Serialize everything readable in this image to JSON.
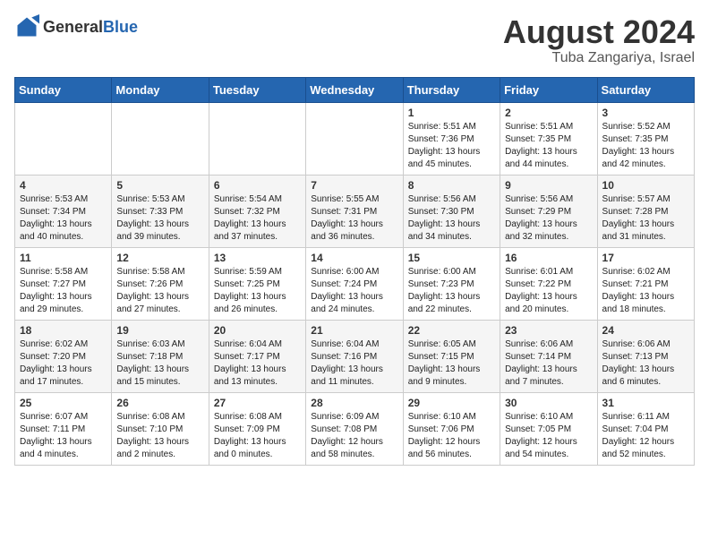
{
  "header": {
    "logo_general": "General",
    "logo_blue": "Blue",
    "month_year": "August 2024",
    "location": "Tuba Zangariya, Israel"
  },
  "days_of_week": [
    "Sunday",
    "Monday",
    "Tuesday",
    "Wednesday",
    "Thursday",
    "Friday",
    "Saturday"
  ],
  "weeks": [
    [
      {
        "day": "",
        "info": ""
      },
      {
        "day": "",
        "info": ""
      },
      {
        "day": "",
        "info": ""
      },
      {
        "day": "",
        "info": ""
      },
      {
        "day": "1",
        "info": "Sunrise: 5:51 AM\nSunset: 7:36 PM\nDaylight: 13 hours and 45 minutes."
      },
      {
        "day": "2",
        "info": "Sunrise: 5:51 AM\nSunset: 7:35 PM\nDaylight: 13 hours and 44 minutes."
      },
      {
        "day": "3",
        "info": "Sunrise: 5:52 AM\nSunset: 7:35 PM\nDaylight: 13 hours and 42 minutes."
      }
    ],
    [
      {
        "day": "4",
        "info": "Sunrise: 5:53 AM\nSunset: 7:34 PM\nDaylight: 13 hours and 40 minutes."
      },
      {
        "day": "5",
        "info": "Sunrise: 5:53 AM\nSunset: 7:33 PM\nDaylight: 13 hours and 39 minutes."
      },
      {
        "day": "6",
        "info": "Sunrise: 5:54 AM\nSunset: 7:32 PM\nDaylight: 13 hours and 37 minutes."
      },
      {
        "day": "7",
        "info": "Sunrise: 5:55 AM\nSunset: 7:31 PM\nDaylight: 13 hours and 36 minutes."
      },
      {
        "day": "8",
        "info": "Sunrise: 5:56 AM\nSunset: 7:30 PM\nDaylight: 13 hours and 34 minutes."
      },
      {
        "day": "9",
        "info": "Sunrise: 5:56 AM\nSunset: 7:29 PM\nDaylight: 13 hours and 32 minutes."
      },
      {
        "day": "10",
        "info": "Sunrise: 5:57 AM\nSunset: 7:28 PM\nDaylight: 13 hours and 31 minutes."
      }
    ],
    [
      {
        "day": "11",
        "info": "Sunrise: 5:58 AM\nSunset: 7:27 PM\nDaylight: 13 hours and 29 minutes."
      },
      {
        "day": "12",
        "info": "Sunrise: 5:58 AM\nSunset: 7:26 PM\nDaylight: 13 hours and 27 minutes."
      },
      {
        "day": "13",
        "info": "Sunrise: 5:59 AM\nSunset: 7:25 PM\nDaylight: 13 hours and 26 minutes."
      },
      {
        "day": "14",
        "info": "Sunrise: 6:00 AM\nSunset: 7:24 PM\nDaylight: 13 hours and 24 minutes."
      },
      {
        "day": "15",
        "info": "Sunrise: 6:00 AM\nSunset: 7:23 PM\nDaylight: 13 hours and 22 minutes."
      },
      {
        "day": "16",
        "info": "Sunrise: 6:01 AM\nSunset: 7:22 PM\nDaylight: 13 hours and 20 minutes."
      },
      {
        "day": "17",
        "info": "Sunrise: 6:02 AM\nSunset: 7:21 PM\nDaylight: 13 hours and 18 minutes."
      }
    ],
    [
      {
        "day": "18",
        "info": "Sunrise: 6:02 AM\nSunset: 7:20 PM\nDaylight: 13 hours and 17 minutes."
      },
      {
        "day": "19",
        "info": "Sunrise: 6:03 AM\nSunset: 7:18 PM\nDaylight: 13 hours and 15 minutes."
      },
      {
        "day": "20",
        "info": "Sunrise: 6:04 AM\nSunset: 7:17 PM\nDaylight: 13 hours and 13 minutes."
      },
      {
        "day": "21",
        "info": "Sunrise: 6:04 AM\nSunset: 7:16 PM\nDaylight: 13 hours and 11 minutes."
      },
      {
        "day": "22",
        "info": "Sunrise: 6:05 AM\nSunset: 7:15 PM\nDaylight: 13 hours and 9 minutes."
      },
      {
        "day": "23",
        "info": "Sunrise: 6:06 AM\nSunset: 7:14 PM\nDaylight: 13 hours and 7 minutes."
      },
      {
        "day": "24",
        "info": "Sunrise: 6:06 AM\nSunset: 7:13 PM\nDaylight: 13 hours and 6 minutes."
      }
    ],
    [
      {
        "day": "25",
        "info": "Sunrise: 6:07 AM\nSunset: 7:11 PM\nDaylight: 13 hours and 4 minutes."
      },
      {
        "day": "26",
        "info": "Sunrise: 6:08 AM\nSunset: 7:10 PM\nDaylight: 13 hours and 2 minutes."
      },
      {
        "day": "27",
        "info": "Sunrise: 6:08 AM\nSunset: 7:09 PM\nDaylight: 13 hours and 0 minutes."
      },
      {
        "day": "28",
        "info": "Sunrise: 6:09 AM\nSunset: 7:08 PM\nDaylight: 12 hours and 58 minutes."
      },
      {
        "day": "29",
        "info": "Sunrise: 6:10 AM\nSunset: 7:06 PM\nDaylight: 12 hours and 56 minutes."
      },
      {
        "day": "30",
        "info": "Sunrise: 6:10 AM\nSunset: 7:05 PM\nDaylight: 12 hours and 54 minutes."
      },
      {
        "day": "31",
        "info": "Sunrise: 6:11 AM\nSunset: 7:04 PM\nDaylight: 12 hours and 52 minutes."
      }
    ]
  ]
}
